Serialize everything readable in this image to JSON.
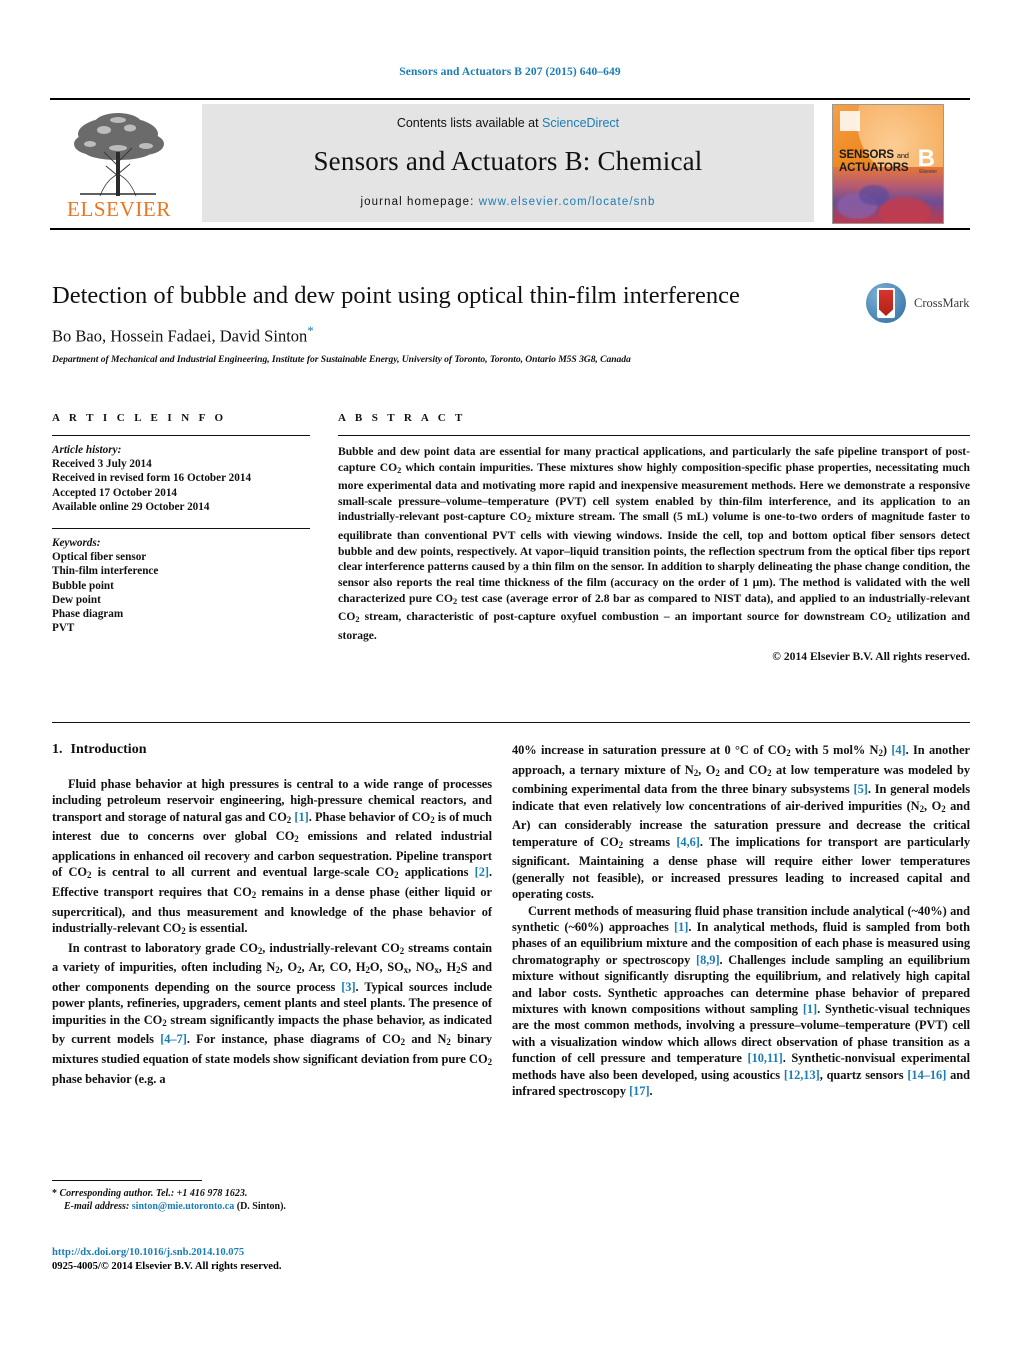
{
  "running_head": "Sensors and Actuators B 207 (2015) 640–649",
  "masthead": {
    "contents_prefix": "Contents lists available at ",
    "sciencedirect": "ScienceDirect",
    "journal_title": "Sensors and Actuators B: Chemical",
    "homepage_prefix": "journal homepage: ",
    "homepage_url": "www.elsevier.com/locate/snb",
    "publisher": "ELSEVIER",
    "cover": {
      "line1": "SENSORS",
      "and": "and",
      "line2": "ACTUATORS",
      "letter": "B",
      "sub": "Elsevier"
    },
    "accent_blue": "#1a7db6",
    "elsevier_orange": "#E87722"
  },
  "article": {
    "title": "Detection of bubble and dew point using optical thin-film interference",
    "authors": "Bo Bao, Hossein Fadaei, David Sinton",
    "corresponding_marker": "*",
    "affiliation": "Department of Mechanical and Industrial Engineering, Institute for Sustainable Energy, University of Toronto, Toronto, Ontario M5S 3G8, Canada",
    "crossmark_label": "CrossMark"
  },
  "article_info": {
    "heading": "A R T I C L E   I N F O",
    "history_label": "Article history:",
    "history": [
      "Received 3 July 2014",
      "Received in revised form 16 October 2014",
      "Accepted 17 October 2014",
      "Available online 29 October 2014"
    ],
    "keywords_label": "Keywords:",
    "keywords": [
      "Optical fiber sensor",
      "Thin-film interference",
      "Bubble point",
      "Dew point",
      "Phase diagram",
      "PVT"
    ]
  },
  "abstract": {
    "heading": "A B S T R A C T",
    "copyright": "© 2014 Elsevier B.V. All rights reserved."
  },
  "introduction": {
    "number": "1.",
    "heading": "Introduction"
  },
  "footnote": {
    "corresponding": "Corresponding author. Tel.: +1 416 978 1623.",
    "email_label": "E-mail address:",
    "email": "sinton@mie.utoronto.ca",
    "email_suffix": "(D. Sinton)."
  },
  "footer": {
    "doi": "http://dx.doi.org/10.1016/j.snb.2014.10.075",
    "issn_line": "0925-4005/© 2014 Elsevier B.V. All rights reserved."
  }
}
